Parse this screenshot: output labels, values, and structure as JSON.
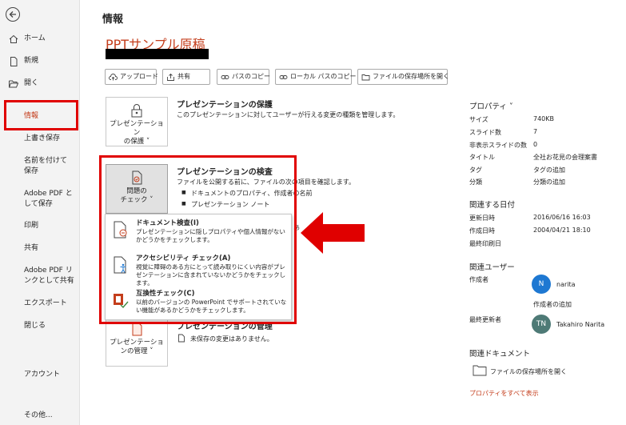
{
  "colors": {
    "accent": "#c43e1c",
    "highlight": "#e00000",
    "avatar_n": "#1e78d2",
    "avatar_tn": "#4e7a76"
  },
  "sidebar": {
    "back_icon": "back-arrow-icon",
    "items": [
      {
        "label": "ホーム",
        "icon": "home-icon"
      },
      {
        "label": "新規",
        "icon": "new-document-icon"
      },
      {
        "label": "開く",
        "icon": "folder-open-icon"
      },
      {
        "label": "情報"
      },
      {
        "label": "上書き保存"
      },
      {
        "label": "名前を付けて保存"
      },
      {
        "label": "Adobe PDF として保存"
      },
      {
        "label": "印刷"
      },
      {
        "label": "共有"
      },
      {
        "label": "Adobe PDF リンクとして共有"
      },
      {
        "label": "エクスポート"
      },
      {
        "label": "閉じる"
      },
      {
        "label": "アカウント"
      },
      {
        "label": "その他..."
      }
    ]
  },
  "main": {
    "page_title": "情報",
    "doc_title": "PPTサンプル原稿",
    "toolbar": {
      "upload": "アップロード",
      "share": "共有",
      "copy_path": "パスのコピー",
      "copy_local_path": "ローカル パスのコピー",
      "open_location": "ファイルの保存場所を開く"
    },
    "protect": {
      "tile": "プレゼンテーション\nの保護 ˅",
      "title": "プレゼンテーションの保護",
      "desc": "このプレゼンテーションに対してユーザーが行える変更の種類を管理します。"
    },
    "inspect": {
      "tile": "問題の\nチェック ˅",
      "title": "プレゼンテーションの検査",
      "desc": "ファイルを公開する前に、ファイルの次の項目を確認します。",
      "bullets": [
        "ドキュメントのプロパティ、作成者の名前",
        "プレゼンテーション ノート"
      ],
      "peek": "あ"
    },
    "dropdown": [
      {
        "title": "ドキュメント検査(I)",
        "desc": "プレゼンテーションに隠しプロパティや個人情報がないかどうかをチェックします。",
        "icon": "document-inspect-icon"
      },
      {
        "title": "アクセシビリティ チェック(A)",
        "desc": "視覚に障碍のある方にとって読み取りにくい内容がプレゼンテーションに含まれていないかどうかをチェックします。",
        "icon": "accessibility-check-icon"
      },
      {
        "title": "互換性チェック(C)",
        "desc": "以前のバージョンの PowerPoint でサポートされていない機能があるかどうかをチェックします。",
        "icon": "compatibility-check-icon"
      }
    ],
    "manage": {
      "tile": "プレゼンテーショ\nンの管理 ˅",
      "title": "プレゼンテーションの管理",
      "desc": "未保存の変更はありません。"
    }
  },
  "properties": {
    "header": "プロパティ ˅",
    "rows": [
      {
        "key": "サイズ",
        "value": "740KB"
      },
      {
        "key": "スライド数",
        "value": "7"
      },
      {
        "key": "非表示スライドの数",
        "value": "0"
      },
      {
        "key": "タイトル",
        "value": "全社お花見の会理案書"
      },
      {
        "key": "タグ",
        "value": "タグの追加"
      },
      {
        "key": "分類",
        "value": "分類の追加"
      }
    ],
    "dates_header": "関連する日付",
    "dates": [
      {
        "key": "更新日時",
        "value": "2016/06/16 16:03"
      },
      {
        "key": "作成日時",
        "value": "2004/04/21 18:10"
      },
      {
        "key": "最終印刷日",
        "value": ""
      }
    ],
    "users_header": "関連ユーザー",
    "author_label": "作成者",
    "author_initial": "N",
    "author_name": "narita",
    "add_author": "作成者の追加",
    "last_modified_label": "最終更新者",
    "modifier_initials": "TN",
    "modifier_name": "Takahiro Narita",
    "docs_header": "関連ドキュメント",
    "open_location": "ファイルの保存場所を開く",
    "show_all": "プロパティをすべて表示"
  }
}
